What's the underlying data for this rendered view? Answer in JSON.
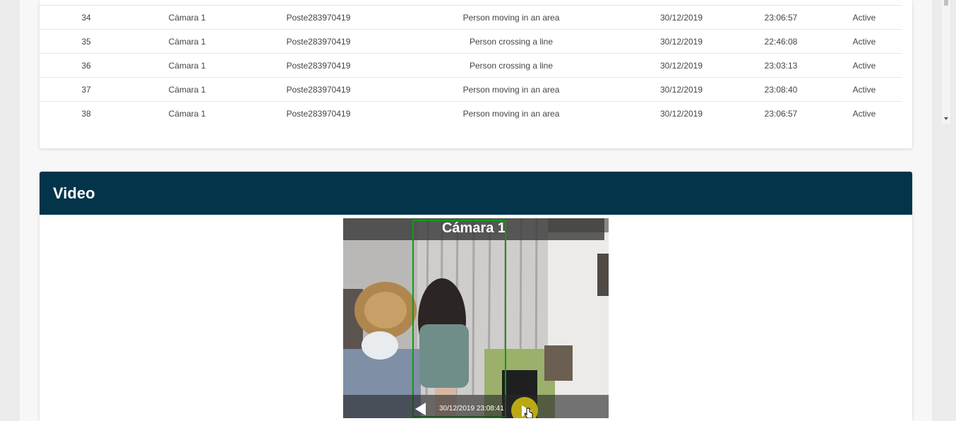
{
  "alerts_table": {
    "rows": [
      {
        "id": "34",
        "camera": "Cámara 1",
        "device": "Poste283970419",
        "event": "Person moving in an area",
        "date": "30/12/2019",
        "time": "23:06:57",
        "status": "Active"
      },
      {
        "id": "35",
        "camera": "Cámara 1",
        "device": "Poste283970419",
        "event": "Person crossing a line",
        "date": "30/12/2019",
        "time": "22:46:08",
        "status": "Active"
      },
      {
        "id": "36",
        "camera": "Cámara 1",
        "device": "Poste283970419",
        "event": "Person crossing a line",
        "date": "30/12/2019",
        "time": "23:03:13",
        "status": "Active"
      },
      {
        "id": "37",
        "camera": "Cámara 1",
        "device": "Poste283970419",
        "event": "Person moving in an area",
        "date": "30/12/2019",
        "time": "23:08:40",
        "status": "Active"
      },
      {
        "id": "38",
        "camera": "Cámara 1",
        "device": "Poste283970419",
        "event": "Person moving in an area",
        "date": "30/12/2019",
        "time": "23:06:57",
        "status": "Active"
      }
    ]
  },
  "video_panel": {
    "title": "Video",
    "camera_label": "Cámara 1",
    "timestamp": "30/12/2019 23:08:41",
    "header_color": "#03344a",
    "detection_box_color": "#0f9a18"
  }
}
